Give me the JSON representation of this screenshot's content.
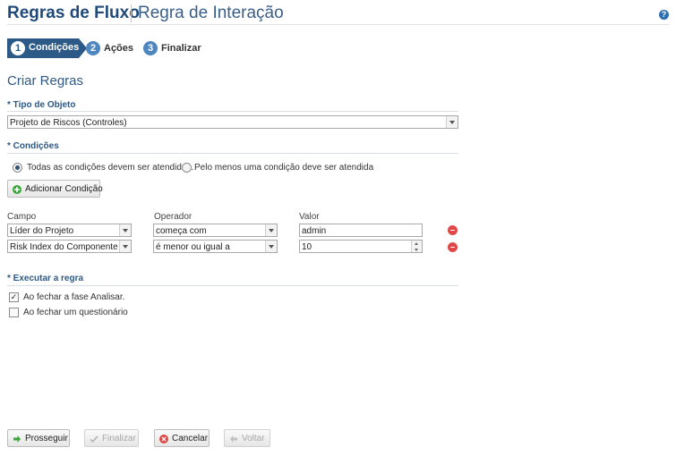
{
  "header": {
    "title": "Regras de Fluxo",
    "subtitle": "Regra de Interação",
    "help_label": "?"
  },
  "steps": [
    {
      "num": "1",
      "label": "Condições",
      "active": true
    },
    {
      "num": "2",
      "label": "Ações",
      "active": false
    },
    {
      "num": "3",
      "label": "Finalizar",
      "active": false
    }
  ],
  "page_heading": "Criar Regras",
  "object_type": {
    "label": "* Tipo de Objeto",
    "value": "Projeto de Riscos (Controles)"
  },
  "conditions": {
    "label": "* Condições",
    "radio_all": "Todas as condições devem ser atendidas.",
    "radio_any": "Pelo menos uma condição deve ser atendida",
    "selected": "all",
    "add_button": "Adicionar Condição",
    "col_field": "Campo",
    "col_operator": "Operador",
    "col_value": "Valor",
    "rows": [
      {
        "field": "Líder do Projeto",
        "operator": "começa com",
        "value": "admin"
      },
      {
        "field": "Risk Index do Componente de A",
        "operator": "é menor ou igual a",
        "value": "10"
      }
    ]
  },
  "execute": {
    "label": "* Executar a regra",
    "options": [
      {
        "label": "Ao fechar a fase Analisar.",
        "checked": true
      },
      {
        "label": "Ao fechar um questionário",
        "checked": false
      }
    ]
  },
  "footer": {
    "next": "Prosseguir",
    "finish": "Finalizar",
    "cancel": "Cancelar",
    "back": "Voltar"
  },
  "colors": {
    "accent": "#2c5986",
    "title": "#1f4a7a",
    "remove": "#e04848",
    "add": "#3aa63a"
  }
}
